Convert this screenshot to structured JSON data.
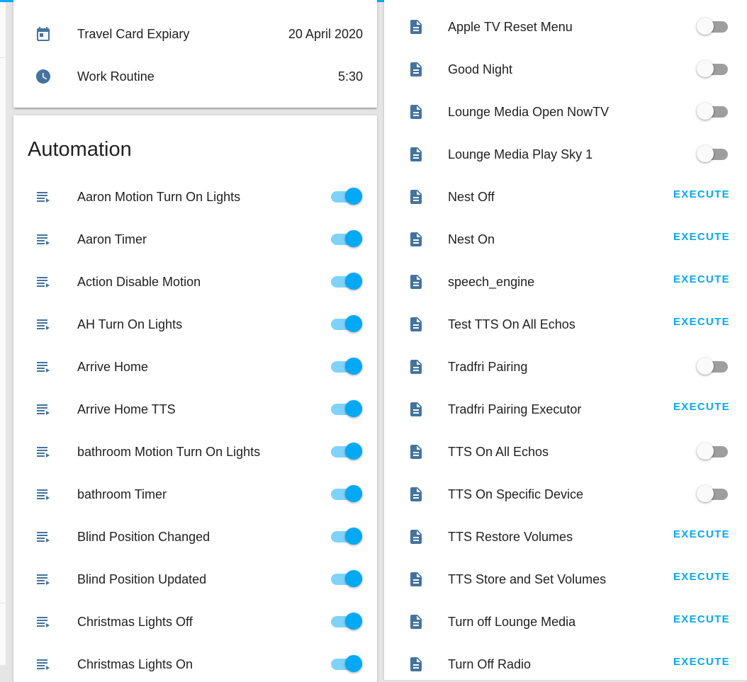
{
  "colors": {
    "accent": "#03a9f4",
    "icon": "#44739e",
    "toggle_track_on": "#7fd3fa",
    "toggle_track_off": "#9e9e9e"
  },
  "top_card": {
    "rows": [
      {
        "icon": "calendar-icon",
        "label": "Travel Card Expiary",
        "value": "20 April 2020"
      },
      {
        "icon": "clock-icon",
        "label": "Work Routine",
        "value": "5:30"
      }
    ]
  },
  "automation": {
    "title": "Automation",
    "items": [
      {
        "label": "Aaron Motion Turn On Lights",
        "state": "on"
      },
      {
        "label": "Aaron Timer",
        "state": "on"
      },
      {
        "label": "Action Disable Motion",
        "state": "on"
      },
      {
        "label": "AH Turn On Lights",
        "state": "on"
      },
      {
        "label": "Arrive Home",
        "state": "on"
      },
      {
        "label": "Arrive Home TTS",
        "state": "on"
      },
      {
        "label": "bathroom Motion Turn On Lights",
        "state": "on"
      },
      {
        "label": "bathroom Timer",
        "state": "on"
      },
      {
        "label": "Blind Position Changed",
        "state": "on"
      },
      {
        "label": "Blind Position Updated",
        "state": "on"
      },
      {
        "label": "Christmas Lights Off",
        "state": "on"
      },
      {
        "label": "Christmas Lights On",
        "state": "on"
      }
    ]
  },
  "scripts": {
    "execute_label": "EXECUTE",
    "items": [
      {
        "label": "Apple TV Reset Menu",
        "control": "toggle",
        "state": "off"
      },
      {
        "label": "Good Night",
        "control": "toggle",
        "state": "off"
      },
      {
        "label": "Lounge Media Open NowTV",
        "control": "toggle",
        "state": "off"
      },
      {
        "label": "Lounge Media Play Sky 1",
        "control": "toggle",
        "state": "off"
      },
      {
        "label": "Nest Off",
        "control": "execute"
      },
      {
        "label": "Nest On",
        "control": "execute"
      },
      {
        "label": "speech_engine",
        "control": "execute"
      },
      {
        "label": "Test TTS On All Echos",
        "control": "execute"
      },
      {
        "label": "Tradfri Pairing",
        "control": "toggle",
        "state": "off"
      },
      {
        "label": "Tradfri Pairing Executor",
        "control": "execute"
      },
      {
        "label": "TTS On All Echos",
        "control": "toggle",
        "state": "off"
      },
      {
        "label": "TTS On Specific Device",
        "control": "toggle",
        "state": "off"
      },
      {
        "label": "TTS Restore Volumes",
        "control": "execute"
      },
      {
        "label": "TTS Store and Set Volumes",
        "control": "execute"
      },
      {
        "label": "Turn off Lounge Media",
        "control": "execute"
      },
      {
        "label": "Turn Off Radio",
        "control": "execute"
      }
    ]
  }
}
